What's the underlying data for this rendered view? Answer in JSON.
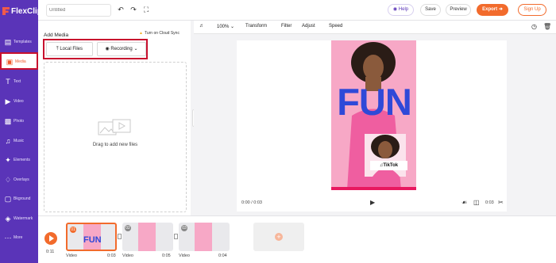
{
  "app": {
    "name": "FlexClip"
  },
  "sidebar": {
    "items": [
      {
        "label": "Templates",
        "icon": "template-icon"
      },
      {
        "label": "Media",
        "icon": "folder-icon"
      },
      {
        "label": "Text",
        "icon": "text-icon"
      },
      {
        "label": "Video",
        "icon": "video-icon"
      },
      {
        "label": "Photo",
        "icon": "photo-icon"
      },
      {
        "label": "Music",
        "icon": "music-icon"
      },
      {
        "label": "Elements",
        "icon": "elements-icon"
      },
      {
        "label": "Overlays",
        "icon": "overlays-icon"
      },
      {
        "label": "Bkground",
        "icon": "background-icon"
      },
      {
        "label": "Watermark",
        "icon": "watermark-icon"
      },
      {
        "label": "More",
        "icon": "more-icon"
      }
    ],
    "active": "Media"
  },
  "topbar": {
    "title_placeholder": "Untitled",
    "help": "Help",
    "save": "Save",
    "preview": "Preview",
    "export": "Export",
    "signup": "Sign Up"
  },
  "panel": {
    "title": "Add Media",
    "cloud_sync": "Turn on Cloud Sync",
    "local_files": "Local Files",
    "recording": "Recording",
    "drop_text": "Drag to add new files"
  },
  "preview_toolbar": {
    "zoom": "100%",
    "transform": "Transform",
    "filter": "Filter",
    "adjust": "Adjust",
    "speed": "Speed"
  },
  "video_frame": {
    "headline": "FUN",
    "badge": "TikTok"
  },
  "playback": {
    "time": "0:00 / 0:03",
    "duration": "0:03"
  },
  "timeline": {
    "current_time": "0:11",
    "clips": [
      {
        "num": "01",
        "label": "Video",
        "duration": "0:03"
      },
      {
        "num": "02",
        "label": "Video",
        "duration": "0:05"
      },
      {
        "num": "03",
        "label": "Video",
        "duration": "0:04"
      }
    ]
  },
  "colors": {
    "brand": "#5a34b8",
    "accent": "#f26b2c",
    "highlight": "#c8102e"
  }
}
